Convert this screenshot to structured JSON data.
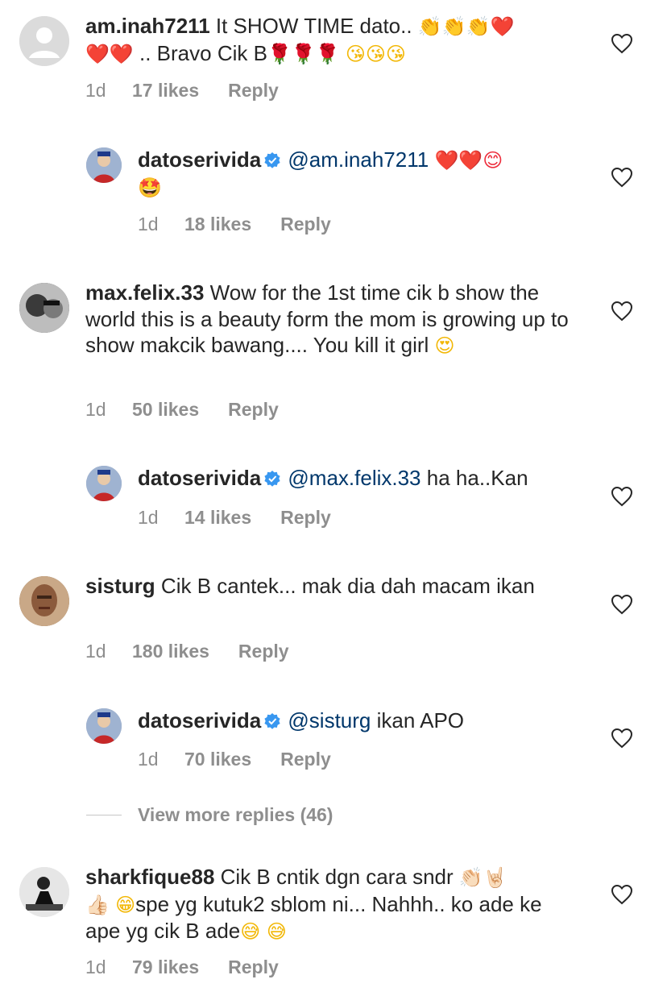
{
  "comments": [
    {
      "username": "am.inah7211",
      "text_1": "It SHOW TIME dato..",
      "emoji_1": "👏👏👏❤️",
      "emoji_2": "❤️❤️",
      "text_2": ".. Bravo Cik B",
      "emoji_3": "🌹🌹🌹",
      "emoji_4": "😘😘😘",
      "time": "1d",
      "likes": "17 likes",
      "reply": "Reply"
    },
    {
      "username": "datoserivida",
      "mention": "@am.inah7211",
      "emoji_1": "❤️❤️😊",
      "emoji_2": "🤩",
      "time": "1d",
      "likes": "18 likes",
      "reply": "Reply"
    },
    {
      "username": "max.felix.33",
      "text": "Wow for the 1st time cik b show the world this is a beauty form the mom is growing up to show makcik bawang.... You kill it girl",
      "emoji": "😍",
      "time": "1d",
      "likes": "50 likes",
      "reply": "Reply"
    },
    {
      "username": "datoserivida",
      "mention": "@max.felix.33",
      "text": "ha ha..Kan",
      "time": "1d",
      "likes": "14 likes",
      "reply": "Reply"
    },
    {
      "username": "sisturg",
      "text": "Cik B cantek... mak dia dah macam ikan",
      "time": "1d",
      "likes": "180 likes",
      "reply": "Reply"
    },
    {
      "username": "datoserivida",
      "mention": "@sisturg",
      "text": "ikan APO",
      "time": "1d",
      "likes": "70 likes",
      "reply": "Reply"
    },
    {
      "username": "sharkfique88",
      "text_1": "Cik B cntik dgn cara sndr",
      "emoji_1": "👏🏻🤘🏻",
      "emoji_2": "👍🏻",
      "emoji_3": "😁",
      "text_2": "spe yg kutuk2 sblom ni... Nahhh.. ko ade ke ape yg cik B ade",
      "emoji_4": "😅 😅",
      "time": "1d",
      "likes": "79 likes",
      "reply": "Reply"
    }
  ],
  "view_more": "View more replies (46)",
  "colors": {
    "mention": "#00376b",
    "meta": "#8e8e8e",
    "verified": "#3897f0",
    "text": "#262626"
  },
  "icons": {
    "like": "heart-outline-icon",
    "verified": "verified-badge-icon"
  }
}
